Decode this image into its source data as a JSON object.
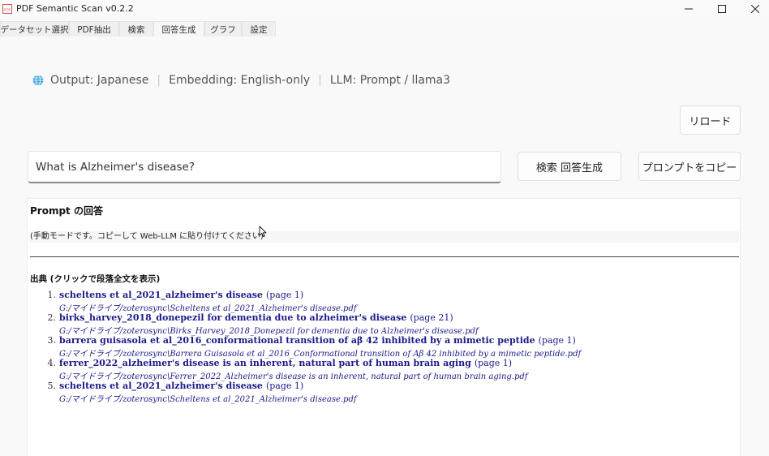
{
  "window": {
    "icon_label": "PDF",
    "title": "PDF Semantic Scan v0.2.2",
    "controls": [
      "minimize-icon",
      "maximize-icon",
      "close-icon"
    ]
  },
  "tabs": [
    {
      "label": "データセット選択",
      "active": false
    },
    {
      "label": "PDF抽出",
      "active": false
    },
    {
      "label": "検索",
      "active": false
    },
    {
      "label": "回答生成",
      "active": true
    },
    {
      "label": "グラフ",
      "active": false
    },
    {
      "label": "設定",
      "active": false
    }
  ],
  "info": {
    "icon": "globe-icon",
    "output": "Output: Japanese",
    "separator": "|",
    "embedding": "Embedding: English-only",
    "llm": "LLM: Prompt / llama3"
  },
  "buttons": {
    "reload": "リロード",
    "search_generate": "検索  回答生成",
    "copy_prompt": "プロンプトをコピー"
  },
  "query": {
    "value": "What is Alzheimer's disease?"
  },
  "answer": {
    "title": "Prompt の回答",
    "mode_note": "(手動モードです。コピーして Web-LLM に貼り付けてください)",
    "sources_heading": "出典 (クリックで段落全文を表示)",
    "sources": [
      {
        "num": "1.",
        "title": "scheltens et al_2021_alzheimer's disease",
        "page": "(page 1)",
        "path": "G:/マイドライブ/zoterosync\\Scheltens et al_2021_Alzheimer's disease.pdf"
      },
      {
        "num": "2.",
        "title": "birks_harvey_2018_donepezil for dementia due to alzheimer's disease",
        "page": "(page 21)",
        "path": "G:/マイドライブ/zoterosync\\Birks_Harvey_2018_Donepezil for dementia due to Alzheimer's disease.pdf"
      },
      {
        "num": "3.",
        "title": "barrera guisasola et al_2016_conformational transition of aβ 42 inhibited by a mimetic peptide",
        "page": "(page 1)",
        "path": "G:/マイドライブ/zoterosync\\Barrera Guisasola et al_2016_Conformational transition of Aβ 42 inhibited by a mimetic peptide.pdf"
      },
      {
        "num": "4.",
        "title": "ferrer_2022_alzheimer's disease is an inherent, natural part of human brain aging",
        "page": "(page 1)",
        "path": "G:/マイドライブ/zoterosync\\Ferrer_2022_Alzheimer's disease is an inherent, natural part of human brain aging.pdf"
      },
      {
        "num": "5.",
        "title": "scheltens et al_2021_alzheimer's disease",
        "page": "(page 1)",
        "path": "G:/マイドライブ/zoterosync\\Scheltens et al_2021_Alzheimer's disease.pdf"
      }
    ]
  },
  "colors": {
    "link": "#1a1a8a",
    "globe": "#3aa0e0",
    "app_icon": "#d9534f"
  }
}
